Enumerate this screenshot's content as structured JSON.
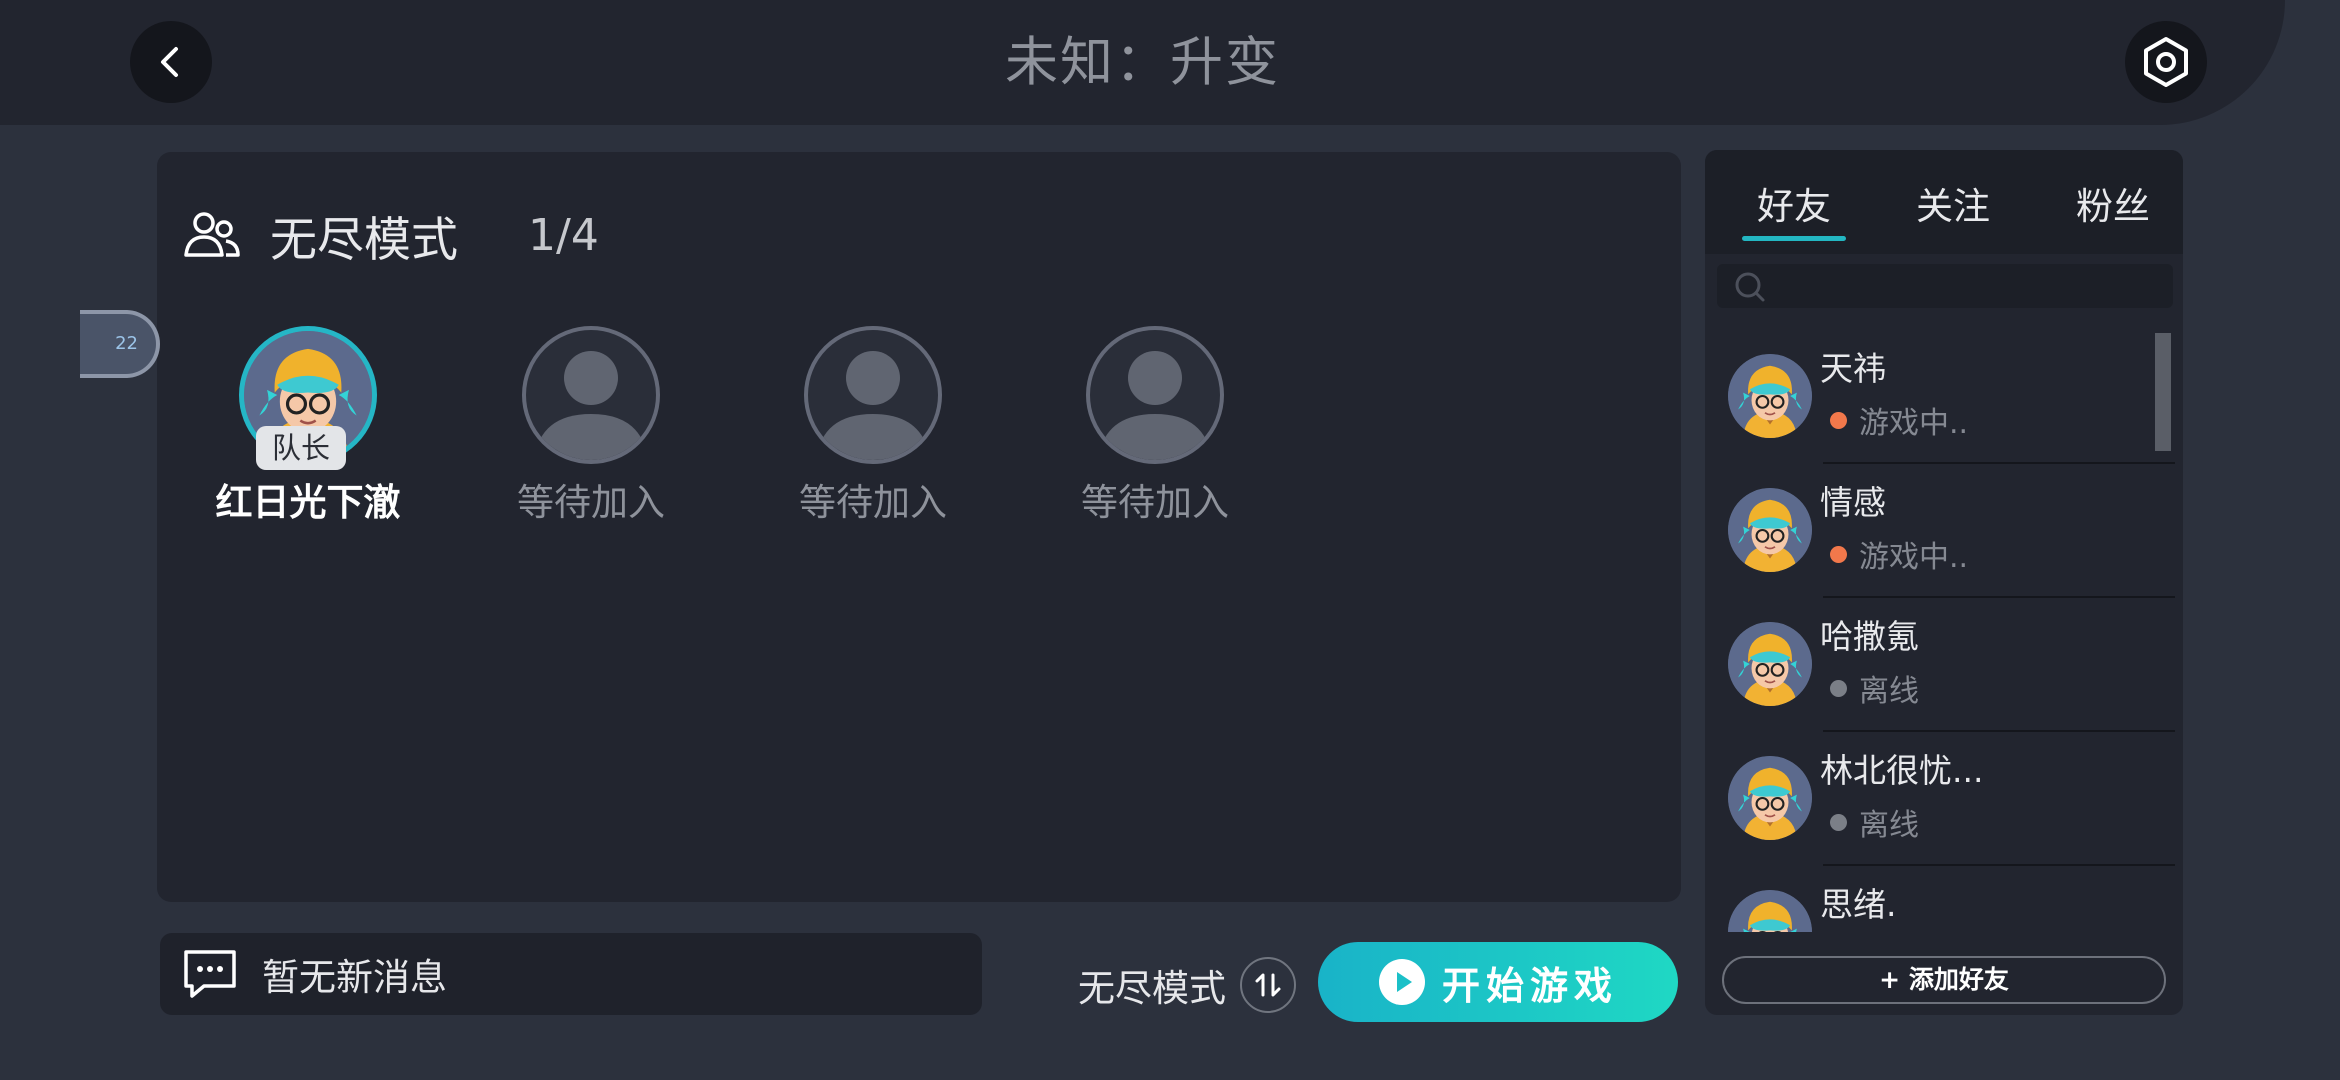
{
  "header": {
    "title": "未知：升变"
  },
  "room": {
    "mode_title": "无尽模式",
    "player_count": "1/4",
    "side_bubble": "22",
    "slots": [
      {
        "name": "红日光下澈",
        "badge": "队长",
        "state": "captain"
      },
      {
        "name": "等待加入",
        "state": "empty"
      },
      {
        "name": "等待加入",
        "state": "empty"
      },
      {
        "name": "等待加入",
        "state": "empty"
      }
    ]
  },
  "messages": {
    "text": "暂无新消息"
  },
  "controls": {
    "mode_label": "无尽模式",
    "start_label": "开始游戏"
  },
  "friends": {
    "tabs": [
      {
        "label": "好友",
        "active": true
      },
      {
        "label": "关注"
      },
      {
        "label": "粉丝"
      }
    ],
    "list": [
      {
        "name": "天祎",
        "status": "游戏中..",
        "online": true
      },
      {
        "name": "情感",
        "status": "游戏中..",
        "online": true
      },
      {
        "name": "哈撒氪",
        "status": "离线",
        "online": false
      },
      {
        "name": "林北很忧...",
        "status": "离线",
        "online": false
      },
      {
        "name": "思绪.",
        "status": "",
        "online": false
      }
    ],
    "add_label": "+ 添加好友"
  },
  "colors": {
    "accent": "#23b6c2",
    "online": "#f2784b",
    "offline": "#7b7f87",
    "start_gradient": [
      "#19b3c8",
      "#1fd8c4"
    ]
  },
  "icons": [
    "back-arrow-icon",
    "settings-hexagon-icon",
    "group-icon",
    "default-avatar-icon",
    "chat-bubble-icon",
    "switch-arrows-icon",
    "play-icon",
    "search-icon"
  ]
}
